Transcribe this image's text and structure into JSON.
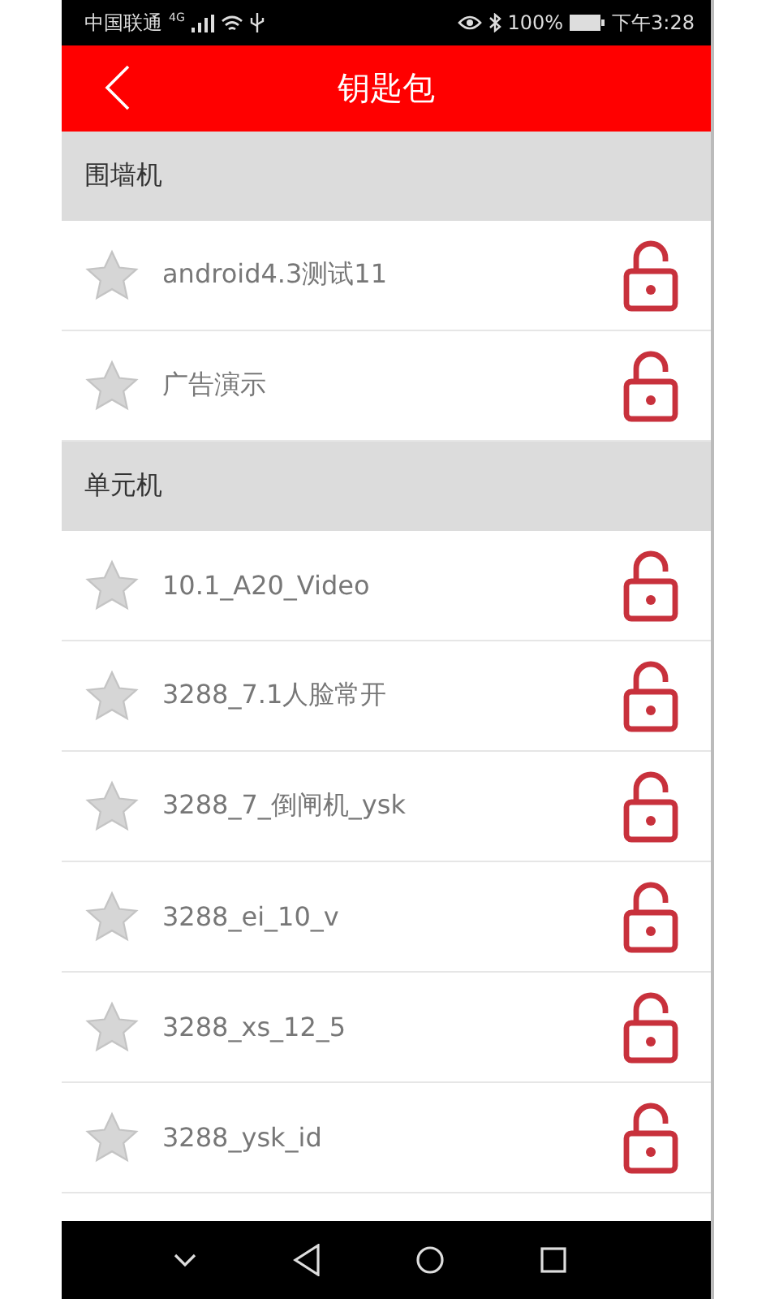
{
  "status_bar": {
    "carrier": "中国联通",
    "network": "4G",
    "battery": "100%",
    "time": "下午3:28"
  },
  "header": {
    "title": "钥匙包"
  },
  "sections": [
    {
      "title": "围墙机",
      "items": [
        {
          "name": "android4.3测试11",
          "favorite": false
        },
        {
          "name": "广告演示",
          "favorite": false
        }
      ]
    },
    {
      "title": "单元机",
      "items": [
        {
          "name": "10.1_A20_Video",
          "favorite": false
        },
        {
          "name": "3288_7.1人脸常开",
          "favorite": false
        },
        {
          "name": "3288_7_倒闸机_ysk",
          "favorite": false
        },
        {
          "name": "3288_ei_10_v",
          "favorite": false
        },
        {
          "name": "3288_xs_12_5",
          "favorite": false
        },
        {
          "name": "3288_ysk_id",
          "favorite": false
        }
      ]
    }
  ]
}
